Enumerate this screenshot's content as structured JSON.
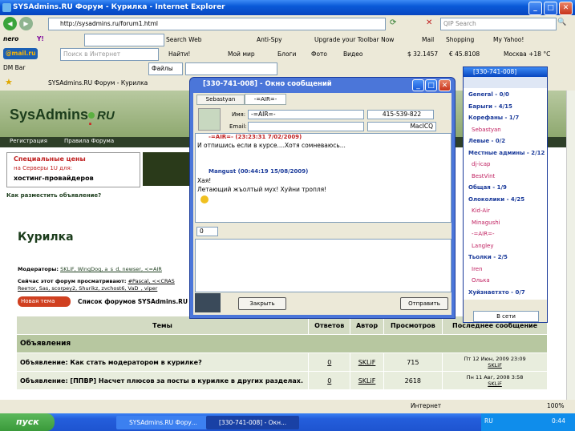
{
  "ie": {
    "title": "SYSAdmins.RU Форум - Курилка - Internet Explorer",
    "address": "http://sysadmins.ru/forum1.html",
    "search_placeholder": "QIP Search",
    "tab_label": "SYSAdmins.RU Форум - Курилка",
    "status_text": "Интернет",
    "zoom": "100%"
  },
  "toolbar1": {
    "nero": "nero",
    "search_web": "Search Web",
    "anti_spy": "Anti-Spy",
    "upgrade": "Upgrade your Toolbar Now",
    "mail": "Mail",
    "shopping": "Shopping",
    "my_yahoo": "My Yahoo!"
  },
  "toolbar2": {
    "mailru": "@mail.ru",
    "search_placeholder": "Поиск в Интернет",
    "find": "Найти!",
    "my_world": "Мой мир",
    "blogs": "Блоги",
    "photo": "Фото",
    "video": "Видео",
    "usd": "$ 32.1457",
    "eur": "€ 45.8108",
    "weather": "Москва +18 °C"
  },
  "toolbar3": {
    "dmbar": "DM Bar",
    "files": "Файлы"
  },
  "forum": {
    "logo_main": "SysAdmins",
    "logo_ru": "RU",
    "nav": [
      "Регистрация",
      "Правила Форума"
    ],
    "banner_line1": "Специальные цены",
    "banner_line2": "на Серверы 1U для:",
    "banner_line3": "хостинг-провайдеров",
    "ad_link": "Как разместить объявление?",
    "page_title": "Курилка",
    "moderators_label": "Модераторы:",
    "moderators": "SKLiF, WingDog, a_s_d, newser, <=AIR",
    "viewing_label": "Сейчас этот форум просматривают:",
    "viewing": "#Pascal, <<CRAS",
    "viewing2": "Reeтor, Sas, scorpey2, Shurikz, zvchost6, VaD_, viper",
    "new_topic": "Новая тема",
    "forum_list": "Список форумов SYSAdmins.RU",
    "columns": [
      "Темы",
      "Ответов",
      "Автор",
      "Просмотров",
      "Последнее сообщение"
    ],
    "section": "Объявления",
    "rows": [
      {
        "title": "Объявление: Как стать модератором в курилке?",
        "replies": "0",
        "author": "SKLiF",
        "views": "715",
        "last_date": "Пт 12 Июн, 2009 23:09",
        "last_author": "SKLiF"
      },
      {
        "title": "Объявление: [ППВР] Насчет плюсов за посты в курилке в других разделах.",
        "replies": "0",
        "author": "SKLiF",
        "views": "2618",
        "last_date": "Пн 11 Авг, 2008 3:58",
        "last_author": "SKLiF"
      }
    ]
  },
  "msgwin": {
    "title": "[330-741-008] - Окно сообщений",
    "tabs": [
      "Sebastyan",
      "-=AIR=-"
    ],
    "name_label": "Имя:",
    "name_value": "-=AIR=-",
    "uin": "415-539-822",
    "email_label": "Email:",
    "client": "MacICQ",
    "msg1_header": "-=AIR=- (23:23:31 7/02/2009)",
    "msg1_text": "И отпишись если в курсе....Хотя сомневаюсь...",
    "msg2_header": "Mangust (00:44:19 15/08/2009)",
    "msg2_line1": "Хая!",
    "msg2_line2": "Летающий жъолтый мух! Хуйни тропля!",
    "counter": "0",
    "close_btn": "Закрыть",
    "send_btn": "Отправить"
  },
  "icq": {
    "title": "[330-741-008]",
    "groups": [
      {
        "label": "General - 0/0",
        "kind": "grp"
      },
      {
        "label": "Барыги - 4/15",
        "kind": "grp"
      },
      {
        "label": "Корефаны - 1/7",
        "kind": "grp"
      },
      {
        "label": "Sebastyan",
        "kind": "on"
      },
      {
        "label": "Левые - 0/2",
        "kind": "grp"
      },
      {
        "label": "Местные админы - 2/12",
        "kind": "grp"
      },
      {
        "label": "dj-icap",
        "kind": "on"
      },
      {
        "label": "BestVint",
        "kind": "on"
      },
      {
        "label": "Общая - 1/9",
        "kind": "grp"
      },
      {
        "label": "Олоколики - 4/25",
        "kind": "grp"
      },
      {
        "label": "Kid-Air",
        "kind": "on"
      },
      {
        "label": "Minagushi",
        "kind": "on"
      },
      {
        "label": "-=AIR=-",
        "kind": "on"
      },
      {
        "label": "Langley",
        "kind": "on"
      },
      {
        "label": "Тьолки - 2/5",
        "kind": "grp"
      },
      {
        "label": "Iren",
        "kind": "on"
      },
      {
        "label": "Олька",
        "kind": "on"
      },
      {
        "label": "Хуйзнаетхто - 0/7",
        "kind": "grp"
      }
    ],
    "status": "В сети"
  },
  "taskbar": {
    "start": "пуск",
    "tasks": [
      "SYSAdmins.RU Фору...",
      "[330-741-008] - Окн..."
    ],
    "lang": "RU",
    "time": "0:44"
  }
}
